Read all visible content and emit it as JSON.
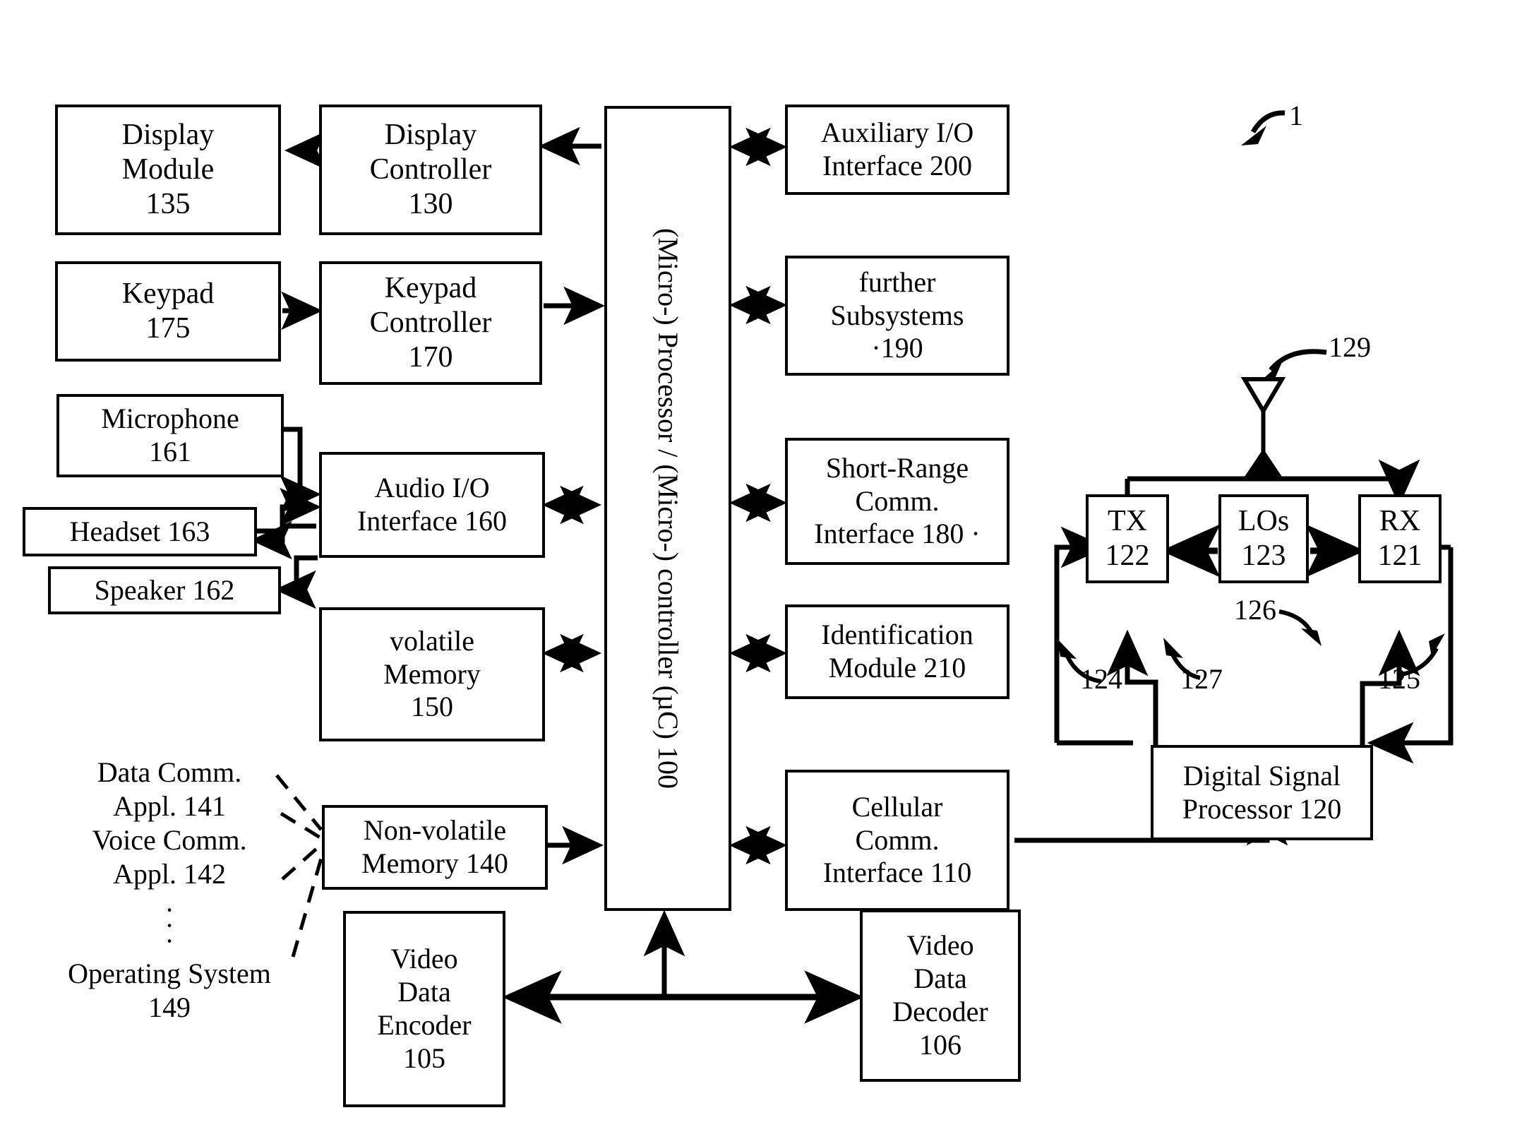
{
  "figure": {
    "figure_label": "1"
  },
  "nodes": {
    "display_module": {
      "lines": [
        "Display",
        "Module",
        "135"
      ]
    },
    "display_controller": {
      "lines": [
        "Display",
        "Controller",
        "130"
      ]
    },
    "keypad": {
      "lines": [
        "Keypad",
        "175"
      ]
    },
    "keypad_controller": {
      "lines": [
        "Keypad",
        "Controller",
        "170"
      ]
    },
    "microphone": {
      "lines": [
        "Microphone",
        "161"
      ]
    },
    "headset": {
      "lines": [
        "Headset 163"
      ]
    },
    "speaker": {
      "lines": [
        "Speaker 162"
      ]
    },
    "audio_io": {
      "lines": [
        "Audio I/O",
        "Interface 160"
      ]
    },
    "volatile_memory": {
      "lines": [
        "volatile",
        "Memory",
        "150"
      ]
    },
    "nonvolatile_memory": {
      "lines": [
        "Non-volatile",
        "Memory 140"
      ]
    },
    "video_encoder": {
      "lines": [
        "Video",
        "Data",
        "Encoder",
        "105"
      ]
    },
    "video_decoder": {
      "lines": [
        "Video",
        "Data",
        "Decoder",
        "106"
      ]
    },
    "cpu": {
      "line1": "(Micro-) Processor / (Micro-) controller (µC)",
      "line2": "100"
    },
    "aux_io": {
      "lines": [
        "Auxiliary I/O",
        "Interface 200"
      ]
    },
    "further_subsystems": {
      "lines": [
        "further",
        "Subsystems",
        "·190"
      ]
    },
    "short_range": {
      "lines": [
        "Short-Range",
        "Comm.",
        "Interface 180 ·"
      ]
    },
    "identification_module": {
      "lines": [
        "Identification",
        "Module 210"
      ]
    },
    "cellular_comm": {
      "lines": [
        "Cellular",
        "Comm.",
        "Interface 110"
      ]
    },
    "tx": {
      "lines": [
        "TX",
        "122"
      ]
    },
    "los": {
      "lines": [
        "LOs",
        "123"
      ]
    },
    "rx": {
      "lines": [
        "RX",
        "121"
      ]
    },
    "dsp": {
      "lines": [
        "Digital Signal",
        "Processor 120"
      ]
    }
  },
  "software_labels": {
    "line1": "Data Comm.",
    "line2": "Appl. 141",
    "line3": "Voice Comm.",
    "line4": "Appl. 142",
    "ellipsis": "·",
    "line5": "Operating System",
    "line6": "149"
  },
  "ref_numerals": {
    "antenna": "129",
    "tx_path": "124",
    "rx_path": "125",
    "rx_feedback": "126",
    "tx_feedback": "127"
  }
}
